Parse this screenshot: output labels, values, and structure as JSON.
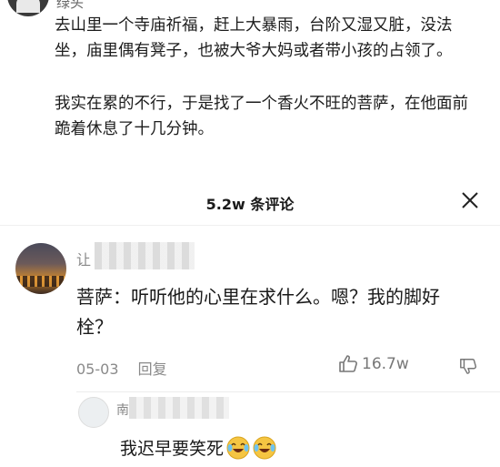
{
  "post": {
    "author": "绿头",
    "paragraphs": [
      "去山里一个寺庙祈福，赶上大暴雨，台阶又湿又脏，没法坐，庙里偶有凳子，也被大爷大妈或者带小孩的占领了。",
      "我实在累的不行，于是找了一个香火不旺的菩萨，在他面前跪着休息了十几分钟。"
    ]
  },
  "comments_header": {
    "count_label": "5.2w 条评论"
  },
  "comment": {
    "author_visible": "让",
    "text": "菩萨：听听他的心里在求什么。嗯？我的脚好栓？",
    "date": "05-03",
    "reply_label": "回复",
    "likes": "16.7w"
  },
  "reply": {
    "author_visible": "南",
    "text": "我迟早要笑死"
  },
  "icons": {
    "close": "close-icon",
    "like": "thumbs-up-icon",
    "dislike": "thumbs-down-icon",
    "emoji": "laughing-crying-emoji-icon"
  },
  "colors": {
    "text": "#1a1a1a",
    "meta": "#8a8a8a",
    "emoji_face": "#f5c542"
  }
}
